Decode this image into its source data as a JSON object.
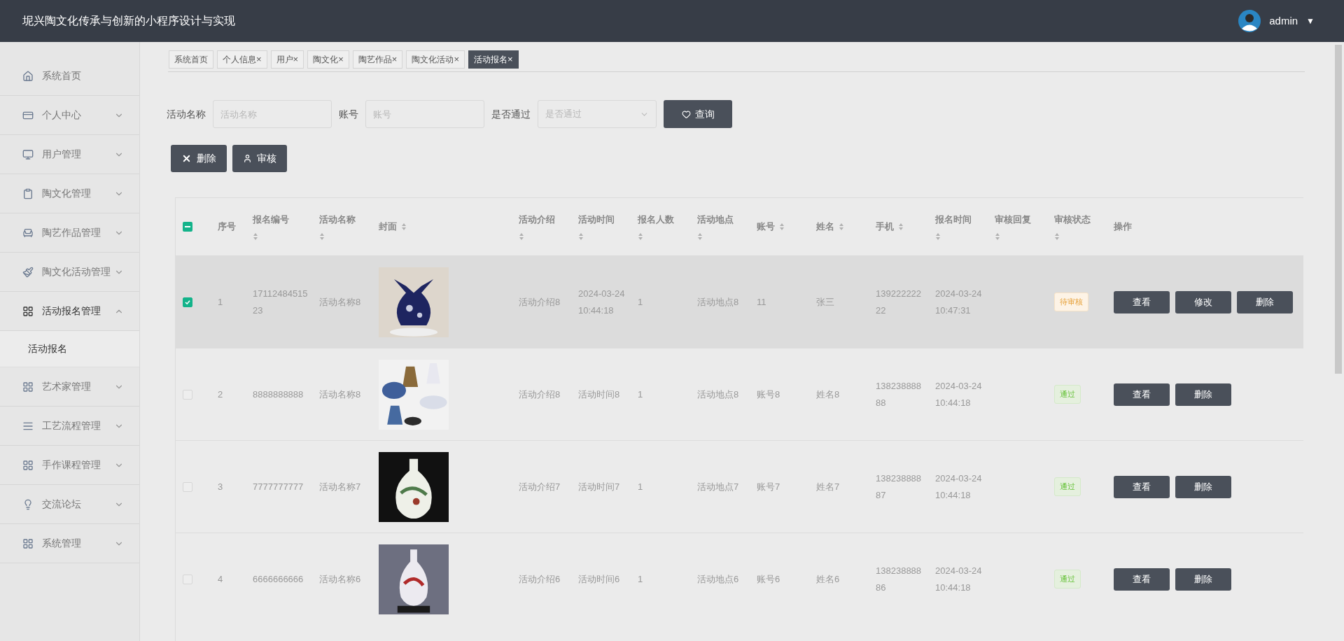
{
  "header": {
    "title": "坭兴陶文化传承与创新的小程序设计与实现",
    "user": "admin",
    "menu_caret": "▼"
  },
  "sidebar": {
    "items": [
      {
        "label": "系统首页",
        "expandable": false,
        "selected": false
      },
      {
        "label": "个人中心",
        "expandable": true,
        "expanded": false,
        "selected": false
      },
      {
        "label": "用户管理",
        "expandable": true,
        "expanded": false,
        "selected": false
      },
      {
        "label": "陶文化管理",
        "expandable": true,
        "expanded": false,
        "selected": false
      },
      {
        "label": "陶艺作品管理",
        "expandable": true,
        "expanded": false,
        "selected": false
      },
      {
        "label": "陶文化活动管理",
        "expandable": true,
        "expanded": false,
        "selected": false
      },
      {
        "label": "活动报名管理",
        "expandable": true,
        "expanded": true,
        "selected": true,
        "children": [
          {
            "label": "活动报名",
            "selected": true
          }
        ]
      },
      {
        "label": "艺术家管理",
        "expandable": true,
        "expanded": false,
        "selected": false
      },
      {
        "label": "工艺流程管理",
        "expandable": true,
        "expanded": false,
        "selected": false
      },
      {
        "label": "手作课程管理",
        "expandable": true,
        "expanded": false,
        "selected": false
      },
      {
        "label": "交流论坛",
        "expandable": true,
        "expanded": false,
        "selected": false
      },
      {
        "label": "系统管理",
        "expandable": true,
        "expanded": false,
        "selected": false
      }
    ]
  },
  "tabs": [
    {
      "label": "系统首页",
      "closable": false,
      "selected": false
    },
    {
      "label": "个人信息",
      "closable": true,
      "selected": false
    },
    {
      "label": "用户",
      "closable": true,
      "selected": false
    },
    {
      "label": "陶文化",
      "closable": true,
      "selected": false
    },
    {
      "label": "陶艺作品",
      "closable": true,
      "selected": false
    },
    {
      "label": "陶文化活动",
      "closable": true,
      "selected": false
    },
    {
      "label": "活动报名",
      "closable": true,
      "selected": true
    }
  ],
  "tab_close": "×",
  "search": {
    "fields": [
      {
        "kind": "input",
        "label": "活动名称",
        "placeholder": "活动名称"
      },
      {
        "kind": "input",
        "label": "账号",
        "placeholder": "账号"
      },
      {
        "kind": "select",
        "label": "是否通过",
        "placeholder": "是否通过"
      }
    ],
    "button": "查询"
  },
  "actions": [
    {
      "kind": "delete",
      "label": "删除"
    },
    {
      "kind": "audit",
      "label": "审核"
    }
  ],
  "table": {
    "select_all_indeterminate": true,
    "columns": [
      {
        "label": "序号",
        "sortable": false,
        "sort_below": false
      },
      {
        "label": "报名编号",
        "sortable": true,
        "sort_below": true
      },
      {
        "label": "活动名称",
        "sortable": true,
        "sort_below": true
      },
      {
        "label": "封面",
        "sortable": true,
        "sort_below": false
      },
      {
        "label": "活动介绍",
        "sortable": true,
        "sort_below": true
      },
      {
        "label": "活动时间",
        "sortable": true,
        "sort_below": true
      },
      {
        "label": "报名人数",
        "sortable": true,
        "sort_below": true
      },
      {
        "label": "活动地点",
        "sortable": true,
        "sort_below": true
      },
      {
        "label": "账号",
        "sortable": true,
        "sort_below": false
      },
      {
        "label": "姓名",
        "sortable": true,
        "sort_below": false
      },
      {
        "label": "手机",
        "sortable": true,
        "sort_below": false
      },
      {
        "label": "报名时间",
        "sortable": true,
        "sort_below": true
      },
      {
        "label": "审核回复",
        "sortable": true,
        "sort_below": true
      },
      {
        "label": "审核状态",
        "sortable": true,
        "sort_below": true
      },
      {
        "label": "操作",
        "sortable": false,
        "sort_below": false
      }
    ],
    "rows": [
      {
        "selected": true,
        "cells": [
          "1",
          "1711248451523",
          "活动名称8",
          {
            "kind": "picture"
          },
          "活动介绍8",
          "2024-03-24 10:44:18",
          "1",
          "活动地点8",
          "11",
          "张三",
          "13922222222",
          "2024-03-24 10:47:31",
          ""
        ],
        "status": {
          "kind": "pending",
          "label": "待审核"
        },
        "buttons": [
          "查看",
          "修改",
          "删除"
        ]
      },
      {
        "selected": false,
        "cells": [
          "2",
          "8888888888",
          "活动名称8",
          {
            "kind": "picture"
          },
          "活动介绍8",
          "活动时间8",
          "1",
          "活动地点8",
          "账号8",
          "姓名8",
          "13823888888",
          "2024-03-24 10:44:18",
          ""
        ],
        "status": {
          "kind": "passed",
          "label": "通过"
        },
        "buttons": [
          "查看",
          "删除"
        ]
      },
      {
        "selected": false,
        "cells": [
          "3",
          "7777777777",
          "活动名称7",
          {
            "kind": "picture"
          },
          "活动介绍7",
          "活动时间7",
          "1",
          "活动地点7",
          "账号7",
          "姓名7",
          "13823888887",
          "2024-03-24 10:44:18",
          ""
        ],
        "status": {
          "kind": "passed",
          "label": "通过"
        },
        "buttons": [
          "查看",
          "删除"
        ]
      },
      {
        "selected": false,
        "cells": [
          "4",
          "6666666666",
          "活动名称6",
          {
            "kind": "picture"
          },
          "活动介绍6",
          "活动时间6",
          "1",
          "活动地点6",
          "账号6",
          "姓名6",
          "13823888886",
          "2024-03-24 10:44:18",
          ""
        ],
        "status": {
          "kind": "passed",
          "label": "通过"
        },
        "buttons": [
          "查看",
          "删除"
        ]
      }
    ]
  }
}
